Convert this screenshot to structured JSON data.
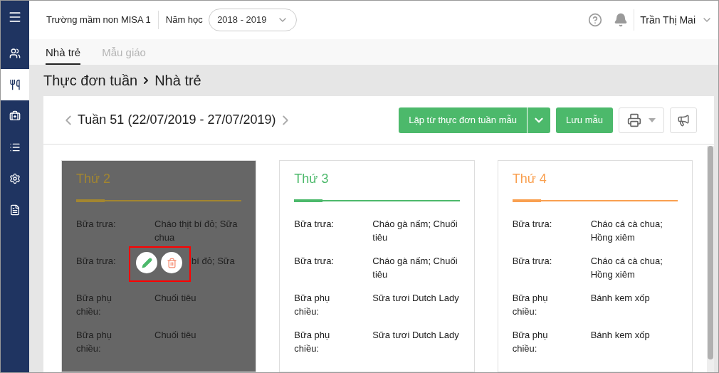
{
  "header": {
    "school": "Trường mầm non MISA 1",
    "year_label": "Năm học",
    "year": "2018 - 2019",
    "user": "Trần Thị Mai"
  },
  "sidebar": {
    "items": [
      {
        "selected": false
      },
      {
        "selected": false
      },
      {
        "selected": true
      },
      {
        "selected": false
      },
      {
        "selected": false
      },
      {
        "selected": false
      },
      {
        "selected": false
      }
    ]
  },
  "tabs": [
    {
      "label": "Nhà trẻ",
      "selected": true
    },
    {
      "label": "Mẫu giáo",
      "selected": false
    }
  ],
  "breadcrumb": {
    "parent": "Thực đơn tuần",
    "current": "Nhà trẻ"
  },
  "week": "Tuần 51 (22/07/2019 - 27/07/2019)",
  "buttons": {
    "create": "Lập từ thực đơn tuần mẫu",
    "save": "Lưu mẫu"
  },
  "days": [
    {
      "title": "Thứ 2",
      "color": "#a38630",
      "hovered": true,
      "meals": [
        {
          "label": "Bữa trưa:",
          "value": "Cháo thịt bí đỏ; Sữa chua"
        },
        {
          "label": "Bữa trưa:",
          "value": "bí đỏ; Sữa",
          "kind": "covered"
        },
        {
          "label": "Bữa phụ chiều:",
          "value": "Chuối tiêu"
        },
        {
          "label": "Bữa phụ chiều:",
          "value": "Chuối tiêu"
        }
      ]
    },
    {
      "title": "Thứ 3",
      "color": "#4cb96b",
      "hovered": false,
      "meals": [
        {
          "label": "Bữa trưa:",
          "value": "Cháo gà nấm; Chuối tiêu"
        },
        {
          "label": "Bữa trưa:",
          "value": "Cháo gà nấm; Chuối tiêu"
        },
        {
          "label": "Bữa phụ chiều:",
          "value": "Sữa tươi Dutch Lady"
        },
        {
          "label": "Bữa phụ chiều:",
          "value": "Sữa tươi Dutch Lady"
        }
      ]
    },
    {
      "title": "Thứ 4",
      "color": "#f9a050",
      "hovered": false,
      "meals": [
        {
          "label": "Bữa trưa:",
          "value": "Cháo cá cà chua; Hồng xiêm"
        },
        {
          "label": "Bữa trưa:",
          "value": "Cháo cá cà chua; Hồng xiêm"
        },
        {
          "label": "Bữa phụ chiều:",
          "value": "Bánh kem xốp"
        },
        {
          "label": "Bữa phụ chiều:",
          "value": "Bánh kem xốp"
        }
      ]
    }
  ]
}
